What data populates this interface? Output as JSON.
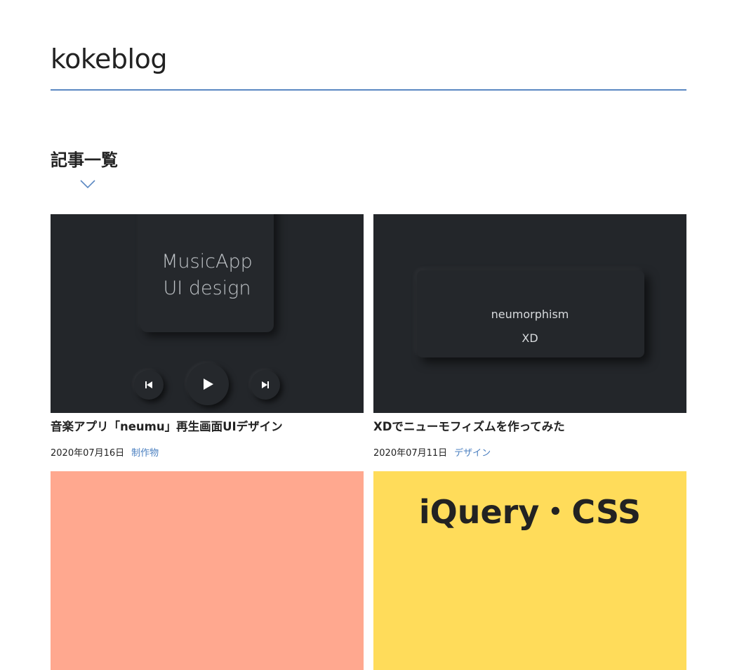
{
  "site": {
    "title": "kokeblog"
  },
  "section": {
    "heading": "記事一覧"
  },
  "colors": {
    "accent": "#5b88c2",
    "category": "#4a7fc0",
    "thumb_dark": "#23262a",
    "thumb_salmon": "#ffa88f",
    "thumb_yellow": "#ffdc5a"
  },
  "articles": [
    {
      "thumb": {
        "line1": "MusicApp",
        "line2": "UI design",
        "icons": [
          "skip-back-icon",
          "play-icon",
          "skip-forward-icon"
        ]
      },
      "title": "音楽アプリ「neumu」再生画面UIデザイン",
      "date": "2020年07月16日",
      "category": "制作物"
    },
    {
      "thumb": {
        "line1": "neumorphism",
        "line2": "XD"
      },
      "title": "XDでニューモフィズムを作ってみた",
      "date": "2020年07月11日",
      "category": "デザイン"
    },
    {
      "thumb": {
        "text": ""
      }
    },
    {
      "thumb": {
        "text": "iQuery・CSS"
      }
    }
  ]
}
